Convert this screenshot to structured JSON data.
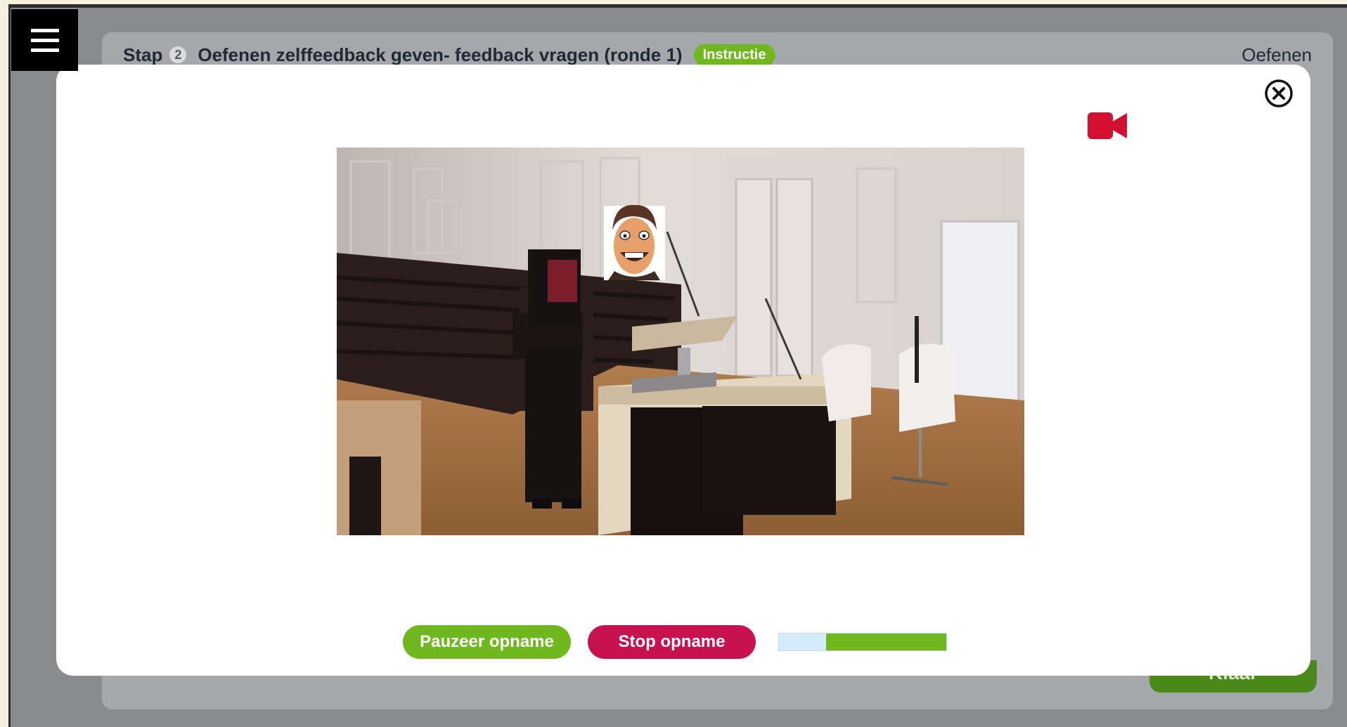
{
  "header": {
    "step_word": "Stap",
    "step_number": "2",
    "step_title": "Oefenen zelffeedback geven- feedback vragen (ronde 1)",
    "badge": "Instructie",
    "mode": "Oefenen"
  },
  "footer": {
    "ready_label": "Klaar"
  },
  "modal": {
    "close_icon": "close-circle-icon",
    "camera_icon": "video-camera-icon",
    "camera_color": "#d0102e",
    "video": {
      "scene": "lecture-hall-podium"
    },
    "controls": {
      "pause_label": "Pauzeer opname",
      "stop_label": "Stop opname",
      "level_meter_fraction": 0.72
    }
  },
  "colors": {
    "accent_green": "#6fb81e",
    "stop_red": "#c8114f",
    "panel_gray": "#a6a7aa"
  }
}
